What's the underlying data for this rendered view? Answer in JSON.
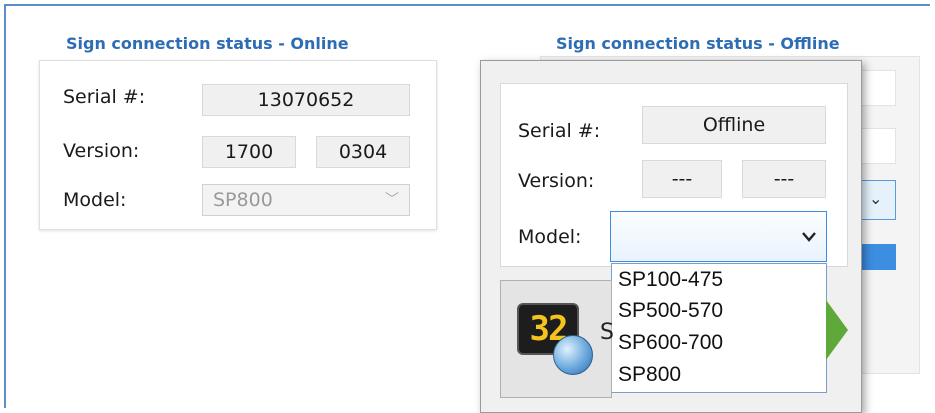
{
  "online_panel": {
    "caption": "Sign connection status - Online",
    "serial_label": "Serial #:",
    "serial_value": "13070652",
    "version_label": "Version:",
    "version_major": "1700",
    "version_minor": "0304",
    "model_label": "Model:",
    "model_value": "SP800",
    "model_enabled": false
  },
  "offline_panel": {
    "caption": "Sign connection status - Offline",
    "serial_label": "Serial #:",
    "serial_value": "Offline",
    "version_label": "Version:",
    "version_major": "---",
    "version_minor": "---",
    "model_label": "Model:",
    "model_value": "",
    "model_options": [
      "SP100-475",
      "SP500-570",
      "SP600-700",
      "SP800"
    ],
    "dropdown_open": true
  },
  "icons": {
    "chevron": "chevron-down-icon",
    "sign_icon_digits": "32",
    "globe": "globe-icon",
    "next_arrow": "next-arrow-icon"
  },
  "colors": {
    "caption": "#2e6db4",
    "frame": "#5b8dc9",
    "focus_border": "#3c8ee0",
    "sign_digits": "#f6c31a"
  }
}
